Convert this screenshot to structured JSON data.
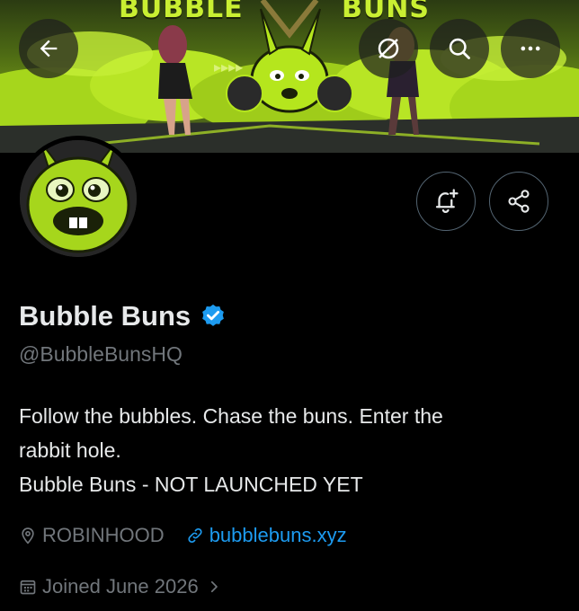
{
  "banner": {
    "title_left": "BUBBLE",
    "title_right": "BUNS"
  },
  "top_bar": {
    "back_icon": "arrow-left-icon",
    "grok_icon": "grok-icon",
    "search_icon": "search-icon",
    "more_icon": "more-horizontal-icon"
  },
  "actions": {
    "notify_icon": "bell-plus-icon",
    "share_icon": "share-icon"
  },
  "profile": {
    "display_name": "Bubble Buns",
    "verified_color": "#1d9bf0",
    "handle": "@BubbleBunsHQ",
    "bio_lines": [
      "Follow the bubbles. Chase the buns. Enter the",
      "rabbit hole.",
      "Bubble Buns - NOT LAUNCHED YET"
    ],
    "location": "ROBINHOOD",
    "website": "bubblebuns.xyz",
    "joined": "Joined June 2026"
  },
  "colors": {
    "background": "#000000",
    "text_primary": "#e7e9ea",
    "text_secondary": "#71767b",
    "link": "#1d9bf0",
    "accent_green": "#b5e61d"
  }
}
